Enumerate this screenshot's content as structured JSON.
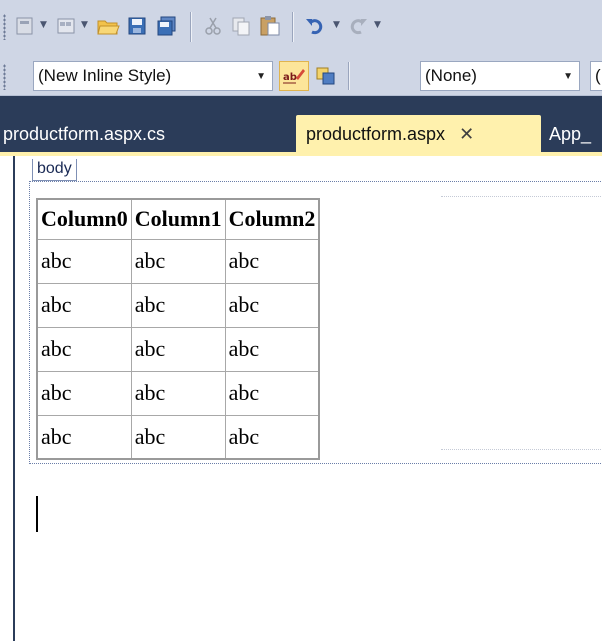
{
  "toolbar_top": {
    "icons": [
      "new-project-icon",
      "add-item-icon",
      "open-folder-icon",
      "save-icon",
      "save-all-icon",
      "cut-icon",
      "copy-icon",
      "paste-icon",
      "undo-icon",
      "redo-icon"
    ]
  },
  "toolbar_format": {
    "style_combo": "(New Inline Style)",
    "target_rule_combo": "(None)",
    "next_combo": "("
  },
  "tabs": [
    {
      "label": "productform.aspx.cs",
      "active": false
    },
    {
      "label": "productform.aspx",
      "active": true,
      "close": "✕"
    },
    {
      "label": "App_",
      "active": false
    }
  ],
  "design": {
    "tag_label": "body",
    "table": {
      "headers": [
        "Column0",
        "Column1",
        "Column2"
      ],
      "rows": [
        [
          "abc",
          "abc",
          "abc"
        ],
        [
          "abc",
          "abc",
          "abc"
        ],
        [
          "abc",
          "abc",
          "abc"
        ],
        [
          "abc",
          "abc",
          "abc"
        ],
        [
          "abc",
          "abc",
          "abc"
        ]
      ]
    }
  },
  "colors": {
    "chrome_bg": "#2b3c59",
    "toolbar_bg": "#cfd6e5",
    "active_tab": "#fff1ad",
    "highlight_button": "#fce59a"
  }
}
